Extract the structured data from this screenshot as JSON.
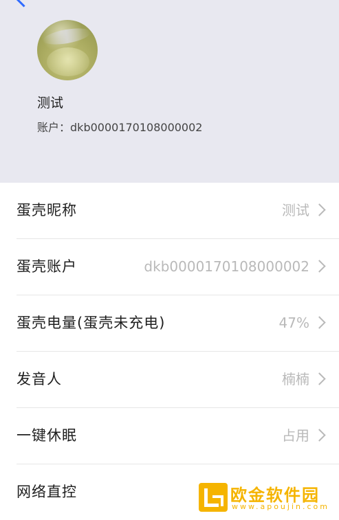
{
  "profile": {
    "name": "测试",
    "account_label": "账户：",
    "account_value": "dkb0000170108000002"
  },
  "list": [
    {
      "label": "蛋壳昵称",
      "value": "测试"
    },
    {
      "label": "蛋壳账户",
      "value": "dkb0000170108000002"
    },
    {
      "label": "蛋壳电量(蛋壳未充电)",
      "value": "47%"
    },
    {
      "label": "发音人",
      "value": "楠楠"
    },
    {
      "label": "一键休眠",
      "value": "占用"
    },
    {
      "label": "网络直控",
      "value": ""
    }
  ],
  "watermark": {
    "text": "欧金软件园",
    "url": "www.apoujin.com"
  },
  "colors": {
    "header_bg": "#e8e8f0",
    "accent": "#2f6bff",
    "value_gray": "#b9b9b9",
    "watermark": "#f5b400"
  }
}
